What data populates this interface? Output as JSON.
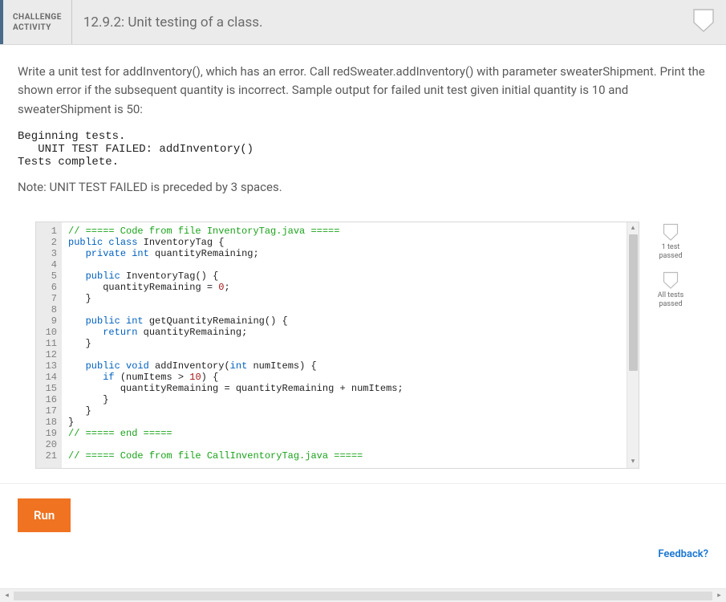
{
  "header": {
    "badge_line1": "CHALLENGE",
    "badge_line2": "ACTIVITY",
    "number": "12.9.2:",
    "title": "Unit testing of a class."
  },
  "prompt": "Write a unit test for addInventory(), which has an error. Call redSweater.addInventory() with parameter sweaterShipment. Print the shown error if the subsequent quantity is incorrect. Sample output for failed unit test given initial quantity is 10 and sweaterShipment is 50:",
  "sample_output": "Beginning tests.\n   UNIT TEST FAILED: addInventory()\nTests complete.",
  "note": "Note: UNIT TEST FAILED is preceded by 3 spaces.",
  "code_lines": [
    [
      [
        "comm",
        "// ===== Code from file InventoryTag.java ====="
      ]
    ],
    [
      [
        "kw",
        "public"
      ],
      [
        "sp",
        " "
      ],
      [
        "kw",
        "class"
      ],
      [
        "sp",
        " "
      ],
      [
        "id",
        "InventoryTag"
      ],
      [
        "sp",
        " "
      ],
      [
        "op",
        "{"
      ]
    ],
    [
      [
        "sp",
        "   "
      ],
      [
        "kw",
        "private"
      ],
      [
        "sp",
        " "
      ],
      [
        "kw",
        "int"
      ],
      [
        "sp",
        " "
      ],
      [
        "id",
        "quantityRemaining"
      ],
      [
        "op",
        ";"
      ]
    ],
    [],
    [
      [
        "sp",
        "   "
      ],
      [
        "kw",
        "public"
      ],
      [
        "sp",
        " "
      ],
      [
        "id",
        "InventoryTag"
      ],
      [
        "op",
        "()"
      ],
      [
        "sp",
        " "
      ],
      [
        "op",
        "{"
      ]
    ],
    [
      [
        "sp",
        "      "
      ],
      [
        "id",
        "quantityRemaining"
      ],
      [
        "sp",
        " "
      ],
      [
        "op",
        "="
      ],
      [
        "sp",
        " "
      ],
      [
        "num",
        "0"
      ],
      [
        "op",
        ";"
      ]
    ],
    [
      [
        "sp",
        "   "
      ],
      [
        "op",
        "}"
      ]
    ],
    [],
    [
      [
        "sp",
        "   "
      ],
      [
        "kw",
        "public"
      ],
      [
        "sp",
        " "
      ],
      [
        "kw",
        "int"
      ],
      [
        "sp",
        " "
      ],
      [
        "id",
        "getQuantityRemaining"
      ],
      [
        "op",
        "()"
      ],
      [
        "sp",
        " "
      ],
      [
        "op",
        "{"
      ]
    ],
    [
      [
        "sp",
        "      "
      ],
      [
        "kw",
        "return"
      ],
      [
        "sp",
        " "
      ],
      [
        "id",
        "quantityRemaining"
      ],
      [
        "op",
        ";"
      ]
    ],
    [
      [
        "sp",
        "   "
      ],
      [
        "op",
        "}"
      ]
    ],
    [],
    [
      [
        "sp",
        "   "
      ],
      [
        "kw",
        "public"
      ],
      [
        "sp",
        " "
      ],
      [
        "kw",
        "void"
      ],
      [
        "sp",
        " "
      ],
      [
        "id",
        "addInventory"
      ],
      [
        "op",
        "("
      ],
      [
        "kw",
        "int"
      ],
      [
        "sp",
        " "
      ],
      [
        "id",
        "numItems"
      ],
      [
        "op",
        ")"
      ],
      [
        "sp",
        " "
      ],
      [
        "op",
        "{"
      ]
    ],
    [
      [
        "sp",
        "      "
      ],
      [
        "kw",
        "if"
      ],
      [
        "sp",
        " "
      ],
      [
        "op",
        "("
      ],
      [
        "id",
        "numItems"
      ],
      [
        "sp",
        " "
      ],
      [
        "op",
        ">"
      ],
      [
        "sp",
        " "
      ],
      [
        "num",
        "10"
      ],
      [
        "op",
        ")"
      ],
      [
        "sp",
        " "
      ],
      [
        "op",
        "{"
      ]
    ],
    [
      [
        "sp",
        "         "
      ],
      [
        "id",
        "quantityRemaining"
      ],
      [
        "sp",
        " "
      ],
      [
        "op",
        "="
      ],
      [
        "sp",
        " "
      ],
      [
        "id",
        "quantityRemaining"
      ],
      [
        "sp",
        " "
      ],
      [
        "op",
        "+"
      ],
      [
        "sp",
        " "
      ],
      [
        "id",
        "numItems"
      ],
      [
        "op",
        ";"
      ]
    ],
    [
      [
        "sp",
        "      "
      ],
      [
        "op",
        "}"
      ]
    ],
    [
      [
        "sp",
        "   "
      ],
      [
        "op",
        "}"
      ]
    ],
    [
      [
        "op",
        "}"
      ]
    ],
    [
      [
        "comm",
        "// ===== end ====="
      ]
    ],
    [],
    [
      [
        "comm",
        "// ===== Code from file CallInventoryTag.java ====="
      ]
    ]
  ],
  "status": {
    "item1_line1": "1 test",
    "item1_line2": "passed",
    "item2_line1": "All tests",
    "item2_line2": "passed"
  },
  "buttons": {
    "run": "Run"
  },
  "links": {
    "feedback": "Feedback?"
  }
}
